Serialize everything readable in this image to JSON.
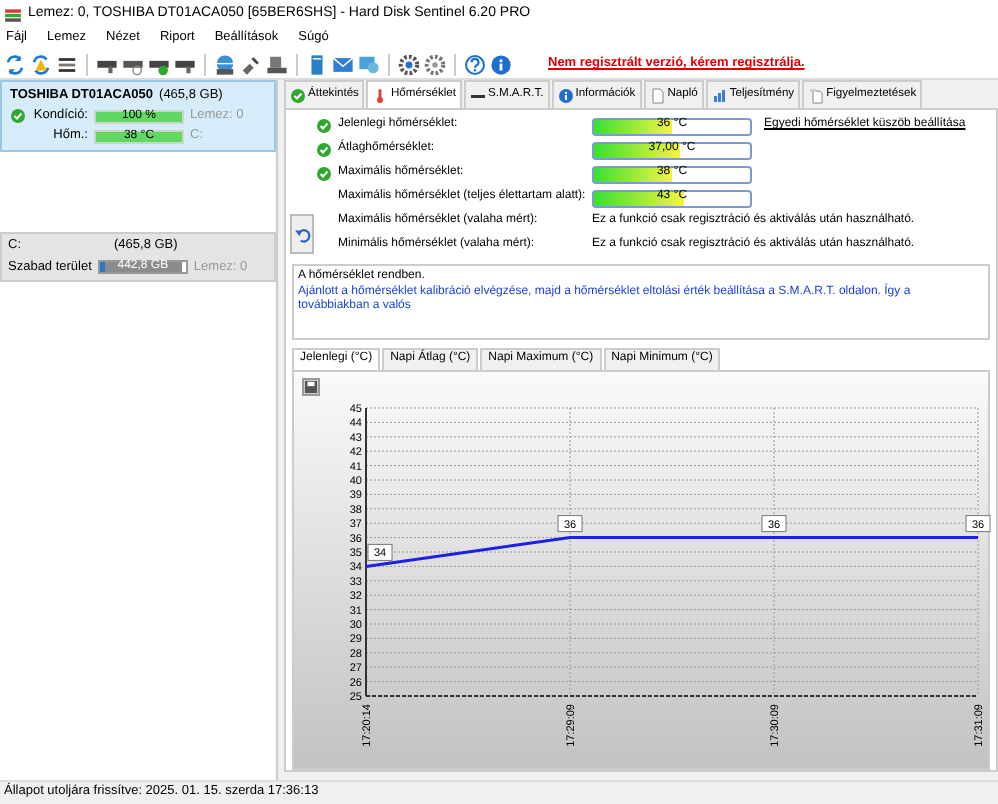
{
  "window": {
    "title": "Lemez: 0, TOSHIBA DT01ACA050 [65BER6SHS]  -  Hard Disk Sentinel 6.20 PRO"
  },
  "menu": [
    "Fájl",
    "Lemez",
    "Nézet",
    "Riport",
    "Beállítások",
    "Súgó"
  ],
  "notice": "Nem regisztrált verzió, kérem regisztrálja.",
  "disk": {
    "name": "TOSHIBA DT01ACA050",
    "size": "(465,8 GB)",
    "selected": true,
    "rows": [
      {
        "label": "Kondíció:",
        "value": "100 %",
        "level": 1,
        "extra": "Lemez: 0",
        "ok": true
      },
      {
        "label": "Hőm.:",
        "value": "38 °C",
        "level": 1,
        "extra": "C:",
        "ok": false
      }
    ]
  },
  "volume": {
    "name": "C:",
    "size": "(465,8 GB)",
    "label": "Szabad terület",
    "value": "442,8 GB",
    "level": 0.95,
    "extra": "Lemez: 0"
  },
  "tabs": [
    {
      "label": "Áttekintés",
      "selected": false
    },
    {
      "label": "Hőmérséklet",
      "selected": true
    },
    {
      "label": "S.M.A.R.T.",
      "selected": false
    },
    {
      "label": "Információk",
      "selected": false
    },
    {
      "label": "Napló",
      "selected": false
    },
    {
      "label": "Teljesítmény",
      "selected": false
    },
    {
      "label": "Figyelmeztetések",
      "selected": false
    }
  ],
  "temperature_rows": [
    {
      "kind": "meter",
      "label": "Jelenlegi hőmérséklet:",
      "value": "36 °C",
      "level": 0.5,
      "ok": true,
      "link": "Egyedi hőmérséklet küszöb beállítása"
    },
    {
      "kind": "meter",
      "label": "Átlaghőmérséklet:",
      "value": "37,00 °C",
      "level": 0.55,
      "ok": true
    },
    {
      "kind": "meter",
      "label": "Maximális hőmérséklet:",
      "value": "38 °C",
      "level": 0.5,
      "ok": true
    },
    {
      "kind": "meter",
      "label": "Maximális hőmérséklet (teljes élettartam alatt):",
      "value": "43 °C",
      "level": 0.58,
      "ok": false
    },
    {
      "kind": "text",
      "label": "Maximális hőmérséklet (valaha mért):",
      "note": "Ez a funkció csak regisztráció és aktiválás után használható."
    },
    {
      "kind": "text",
      "label": "Minimális hőmérséklet (valaha mért):",
      "note": "Ez a funkció csak regisztráció és aktiválás után használható."
    }
  ],
  "message": {
    "status": "A hőmérséklet rendben.",
    "advice": "Ajánlott a hőmérséklet kalibráció elvégzése, majd a hőmérséklet eltolási érték beállítása a S.M.A.R.T. oldalon. Így a továbbiakban a valós"
  },
  "chart_tabs": [
    {
      "label": "Jelenlegi (°C)",
      "selected": true
    },
    {
      "label": "Napi Átlag (°C)",
      "selected": false
    },
    {
      "label": "Napi Maximum (°C)",
      "selected": false
    },
    {
      "label": "Napi Minimum (°C)",
      "selected": false
    }
  ],
  "chart_data": {
    "type": "line",
    "categories": [
      "17:20:14",
      "17:29:09",
      "17:30:09",
      "17:31:09"
    ],
    "grid": true,
    "series": [
      {
        "color": "#1f1fe6",
        "values": [
          34,
          36,
          36,
          36
        ]
      }
    ],
    "ylim": [
      25,
      45
    ],
    "yticks": [
      25,
      26,
      27,
      28,
      29,
      30,
      31,
      32,
      33,
      34,
      35,
      36,
      37,
      38,
      39,
      40,
      41,
      42,
      43,
      44,
      45
    ],
    "data_labels": true
  },
  "status_bar": "Állapot utoljára frissítve: 2025. 01. 15. szerda 17:36:13"
}
